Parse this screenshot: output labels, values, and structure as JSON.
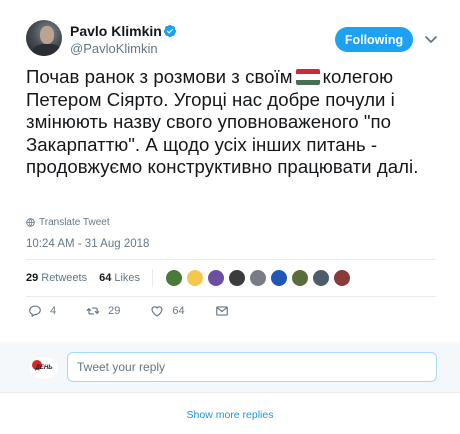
{
  "author": {
    "name": "Pavlo Klimkin",
    "handle": "@PavloKlimkin",
    "verified": true
  },
  "follow_button": {
    "label": "Following",
    "color": "#1da1f2"
  },
  "tweet": {
    "text_before_flag": "Почав ранок з розмови з своїм",
    "flag": "hungary-flag",
    "text_after_flag": "колегою Петером Сіярто.  Угорці нас добре почули і змінюють назву свого уповноваженого \"по Закарпаттю\". А щодо усіх інших питань - продовжуємо конструктивно працювати далі.",
    "translate_label": "Translate Tweet",
    "timestamp": "10:24 AM - 31 Aug 2018"
  },
  "stats": {
    "retweets_count": "29",
    "retweets_label": "Retweets",
    "likes_count": "64",
    "likes_label": "Likes",
    "liker_avatars": [
      "#4a7a3a",
      "#f2c94c",
      "#6b4fa0",
      "#3b3b3b",
      "#777c85",
      "#2456b8",
      "#5a6b3c",
      "#4e5d6c",
      "#8b3a3a"
    ]
  },
  "actions": {
    "reply_count": "4",
    "retweet_count": "29",
    "like_count": "64"
  },
  "reply": {
    "placeholder": "Tweet your reply",
    "avatar_text": "ДЕНЬ"
  },
  "footer": {
    "show_more": "Show more replies"
  },
  "colors": {
    "accent": "#1da1f2",
    "link": "#1b95e0",
    "muted": "#657786",
    "hungary": [
      "#ce2939",
      "#ffffff",
      "#477050"
    ]
  }
}
